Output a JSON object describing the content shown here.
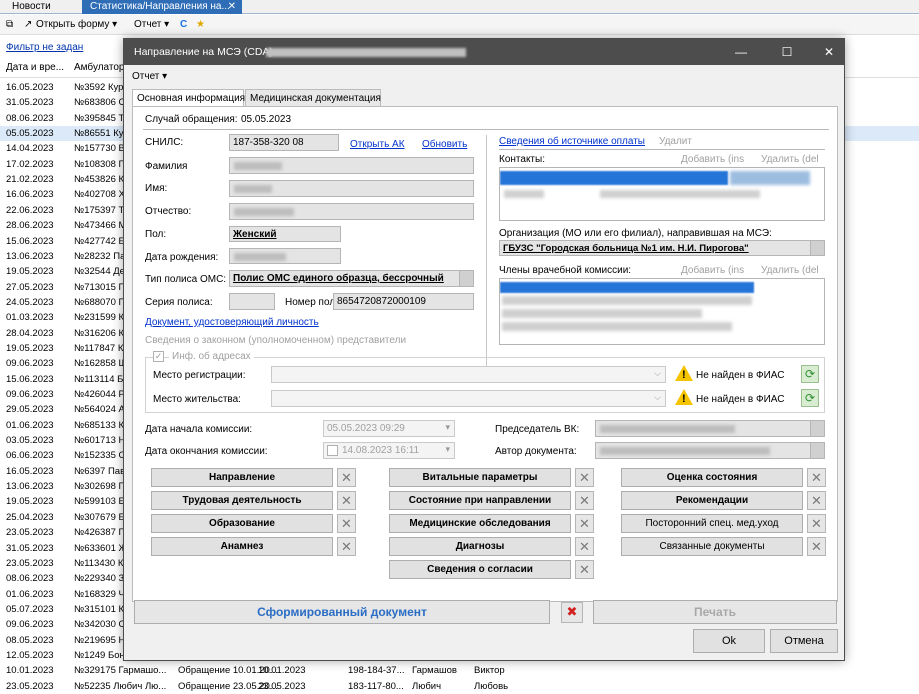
{
  "tabs": [
    {
      "label": "Новости"
    },
    {
      "label": "Статистика/Направления на..."
    }
  ],
  "toolbar": {
    "open_form": "Открыть форму",
    "report": "Отчет"
  },
  "filter_link": "Фильтр не задан",
  "bg_table": {
    "headers": [
      "Дата и вре...",
      "Амбулатор"
    ],
    "dates": [
      "16.05.2023",
      "31.05.2023",
      "08.06.2023",
      "05.05.2023",
      "14.04.2023",
      "17.02.2023",
      "21.02.2023",
      "16.06.2023",
      "22.06.2023",
      "28.06.2023",
      "15.06.2023",
      "13.06.2023",
      "19.05.2023",
      "27.05.2023",
      "24.05.2023",
      "01.03.2023",
      "28.04.2023",
      "19.05.2023",
      "09.06.2023",
      "15.06.2023",
      "09.06.2023",
      "29.05.2023",
      "01.06.2023",
      "03.05.2023",
      "06.06.2023",
      "16.05.2023",
      "13.06.2023",
      "19.05.2023",
      "25.04.2023",
      "23.05.2023",
      "31.05.2023",
      "23.05.2023",
      "08.06.2023",
      "01.06.2023",
      "05.07.2023",
      "09.06.2023",
      "08.05.2023",
      "12.05.2023",
      "10.01.2023",
      "23.05.2023"
    ],
    "ids": [
      "№3592 Кур",
      "№683806 С",
      "№395845 Тр",
      "№86551 Кур",
      "№157730 ВИ",
      "№108308 Гл",
      "№453826 Ки",
      "№402708 Ха",
      "№175397 Тр",
      "№473466 М",
      "№427742 Бе",
      "№28232 Пан",
      "№32544 Ден",
      "№713015 Пе",
      "№688070 Пс",
      "№231599 Ко",
      "№316206 Кр",
      "№117847 Ко",
      "№162858 Ш",
      "№113114 Бо",
      "№426044 Ры",
      "№564024 Ал",
      "№685133 Ко",
      "№601713 На",
      "№152335 СТ",
      "№6397 Пав",
      "№302698 Го",
      "№599103 Ел",
      "№307679 БА",
      "№426387 Па",
      "№633601 Ж",
      "№113430 Ки",
      "№229340 За",
      "№168329 Чу",
      "№315101 Кр",
      "№342030 Са",
      "№219695 Не",
      "№1249 Бонд",
      "№329175 Гармашо...",
      "№52235 Любич Лю..."
    ],
    "row_last1": [
      "Обращение 10.01.20...",
      "10.01.2023",
      "198-184-37...",
      "Гармашов",
      "Виктор"
    ],
    "row_last2": [
      "Обращение 23.05.20...",
      "23.05.2023",
      "183-117-80...",
      "Любич",
      "Любовь"
    ]
  },
  "dialog": {
    "title": "Направление на МСЭ (CDA) -",
    "menu_report": "Отчет",
    "tab_main": "Основная информация",
    "tab_docs": "Медицинская документация",
    "case_label": "Случай обращения:",
    "case_value": "05.05.2023",
    "snils_label": "СНИЛС:",
    "snils_value": "187-358-320 08",
    "open_ak": "Открыть АК",
    "refresh": "Обновить",
    "surname_label": "Фамилия",
    "name_label": "Имя:",
    "patronymic_label": "Отчество:",
    "sex_label": "Пол:",
    "sex_value": "Женский",
    "birth_label": "Дата рождения:",
    "policy_type_label": "Тип полиса ОМС:",
    "policy_type_value": "Полис ОМС единого образца, бессрочный",
    "policy_series_label": "Серия полиса:",
    "policy_number_label": "Номер полиса:",
    "policy_number_value": "8654720872000109",
    "id_doc_link": "Документ, удостоверяющий личность",
    "legal_rep": "Сведения о законном (уполномоченном) представители",
    "payment_link": "Сведения об источнике оплаты",
    "delete": "Удалит",
    "contacts_label": "Контакты:",
    "add_ins": "Добавить (ins",
    "del_del": "Удалить (del",
    "org_label": "Организация (МО или его филиал), направившая на МСЭ:",
    "org_value": "ГБУЗС \"Городская больница №1 им. Н.И. Пирогова\"",
    "commission_label": "Члены врачебной комиссии:",
    "addr_group": "Инф. об адресах",
    "reg_place": "Место регистрации:",
    "live_place": "Место жительства:",
    "fias_not_found": "Не найден в ФИАС",
    "start_label": "Дата начала комиссии:",
    "start_value": "05.05.2023 09:29",
    "end_label": "Дата окончания комиссии:",
    "end_value": "14.08.2023 16:11",
    "chairman_label": "Председатель ВК:",
    "author_label": "Автор документа:",
    "sections_col1": [
      "Направление",
      "Трудовая деятельность",
      "Образование",
      "Анамнез"
    ],
    "sections_col2": [
      "Витальные параметры",
      "Состояние при направлении",
      "Медицинские обследования",
      "Диагнозы",
      "Сведения о согласии"
    ],
    "sections_col3": [
      "Оценка состояния",
      "Рекомендации",
      "Посторонний спец. мед.уход",
      "Связанные документы"
    ],
    "generated_doc": "Сформированный документ",
    "print": "Печать",
    "ok": "Ok",
    "cancel": "Отмена"
  },
  "colors": {
    "accent": "#2f6db7",
    "title_bar": "#4d4d4d",
    "link": "#0033cc"
  }
}
